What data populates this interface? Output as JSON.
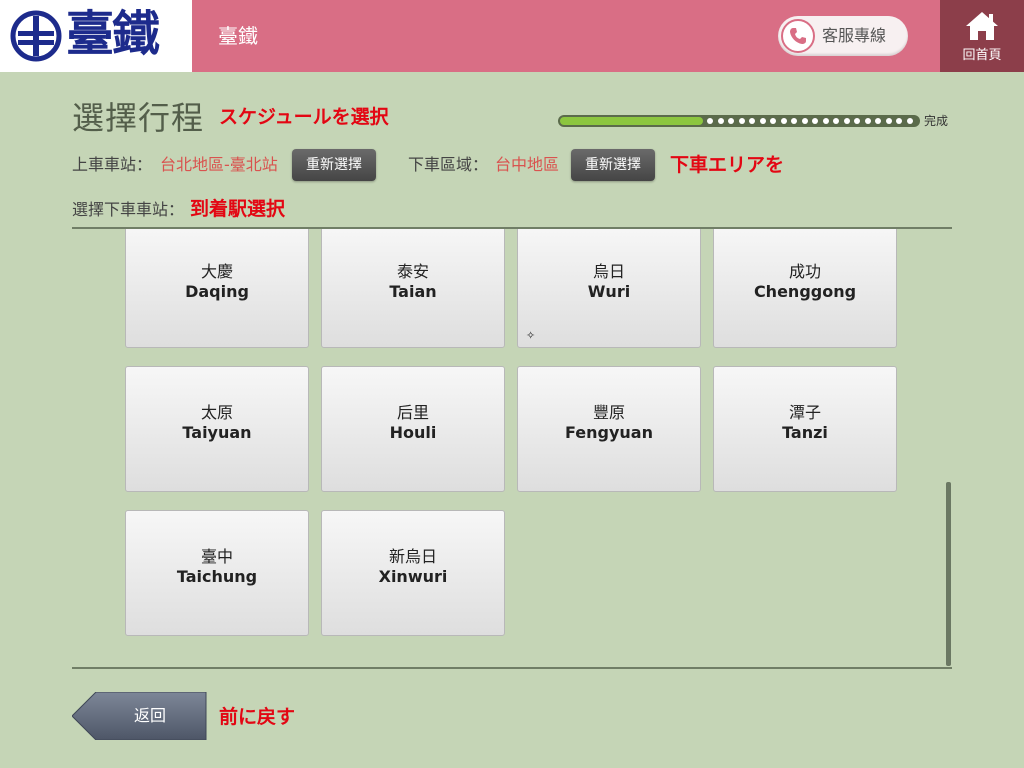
{
  "header": {
    "logo_text": "臺鐵",
    "app_title": "臺鐵",
    "hotline_label": "客服專線",
    "home_label": "回首頁"
  },
  "page": {
    "title": "選擇行程",
    "title_note": "スケジュールを選択",
    "progress": {
      "label": "完成",
      "fraction": 0.4,
      "total_steps": 20
    },
    "boarding_label": "上車車站：",
    "boarding_value": "台北地區-臺北站",
    "reselect_label": "重新選擇",
    "alighting_area_label": "下車區域：",
    "alighting_area_value": "台中地區",
    "alighting_area_note": "下車エリアを",
    "select_station_label": "選擇下車車站：",
    "select_station_note": "到着駅選択"
  },
  "stations": [
    {
      "zh": "大慶",
      "en": "Daqing"
    },
    {
      "zh": "泰安",
      "en": "Taian"
    },
    {
      "zh": "烏日",
      "en": "Wuri"
    },
    {
      "zh": "成功",
      "en": "Chenggong"
    },
    {
      "zh": "太原",
      "en": "Taiyuan"
    },
    {
      "zh": "后里",
      "en": "Houli"
    },
    {
      "zh": "豐原",
      "en": "Fengyuan"
    },
    {
      "zh": "潭子",
      "en": "Tanzi"
    },
    {
      "zh": "臺中",
      "en": "Taichung"
    },
    {
      "zh": "新烏日",
      "en": "Xinwuri"
    }
  ],
  "footer": {
    "back_label": "返回",
    "back_note": "前に戻す"
  },
  "colors": {
    "background": "#c5d5b6",
    "header": "#d96e85",
    "home_button": "#8c3e4a",
    "progress_fill": "#8cc63f",
    "annotation": "#e30613",
    "selected_value": "#d9534f",
    "logo_blue": "#1d2b8c"
  },
  "icons": {
    "logo": "tra-logo-icon",
    "hotline": "phone-icon",
    "home": "house-icon",
    "back": "back-arrow-icon"
  }
}
